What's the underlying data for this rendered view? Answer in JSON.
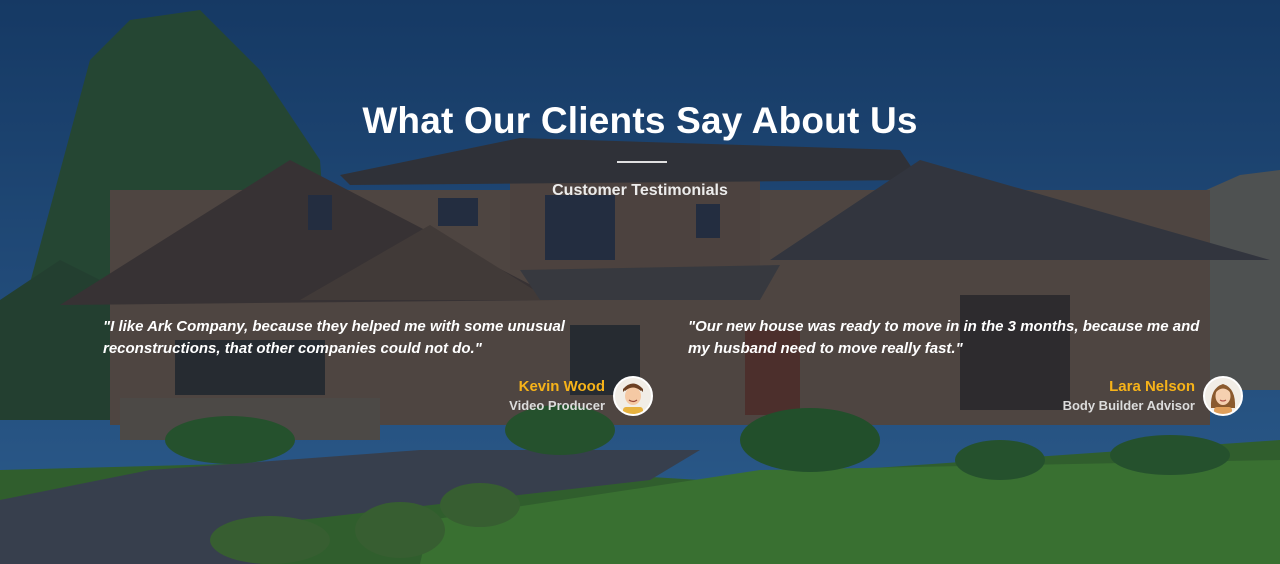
{
  "section": {
    "title": "What Our Clients Say About Us",
    "subtitle": "Customer Testimonials"
  },
  "testimonials": [
    {
      "quote": "\"I like Ark Company, because they helped me with some unusual reconstructions, that other companies could not do.\"",
      "name": "Kevin Wood",
      "role": "Video Producer",
      "avatar": "male-avatar"
    },
    {
      "quote": "\"Our new house was ready to move in in the 3 months, because me and my husband need to move really fast.\"",
      "name": "Lara Nelson",
      "role": "Body Builder Advisor",
      "avatar": "female-avatar"
    }
  ],
  "colors": {
    "accent": "#f7b319",
    "heading": "#ffffff",
    "overlay": "#14223c"
  }
}
